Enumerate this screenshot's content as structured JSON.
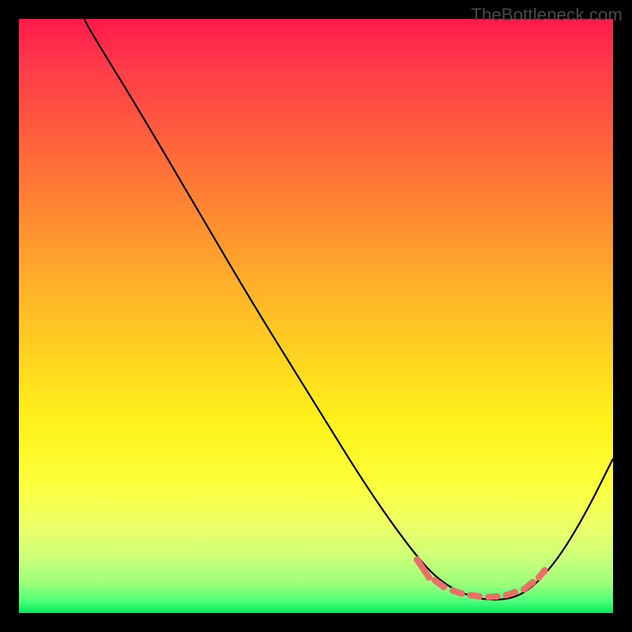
{
  "watermark": "TheBottleneck.com",
  "chart_data": {
    "type": "line",
    "title": "",
    "xlabel": "",
    "ylabel": "",
    "xlim": [
      0,
      100
    ],
    "ylim": [
      0,
      100
    ],
    "curve": [
      {
        "x": 11,
        "y": 100
      },
      {
        "x": 12,
        "y": 98
      },
      {
        "x": 20,
        "y": 85
      },
      {
        "x": 30,
        "y": 68
      },
      {
        "x": 40,
        "y": 51
      },
      {
        "x": 50,
        "y": 35
      },
      {
        "x": 58,
        "y": 22
      },
      {
        "x": 65,
        "y": 12
      },
      {
        "x": 70,
        "y": 6
      },
      {
        "x": 75,
        "y": 3
      },
      {
        "x": 80,
        "y": 2
      },
      {
        "x": 85,
        "y": 3
      },
      {
        "x": 90,
        "y": 8
      },
      {
        "x": 95,
        "y": 16
      },
      {
        "x": 100,
        "y": 26
      }
    ],
    "highlight_range": {
      "x_start": 68,
      "x_end": 87,
      "y": 3
    },
    "highlight_markers": [
      {
        "x1": 67,
        "y1": 9,
        "x2": 69,
        "y2": 6
      },
      {
        "x1": 70,
        "y1": 5.5,
        "x2": 71.5,
        "y2": 4.4
      },
      {
        "x1": 73,
        "y1": 3.8,
        "x2": 74.5,
        "y2": 3.3
      },
      {
        "x1": 76,
        "y1": 3.0,
        "x2": 77.5,
        "y2": 2.8
      },
      {
        "x1": 79,
        "y1": 2.7,
        "x2": 80.5,
        "y2": 2.8
      },
      {
        "x1": 82,
        "y1": 3.0,
        "x2": 83.5,
        "y2": 3.5
      },
      {
        "x1": 85,
        "y1": 4.0,
        "x2": 86.5,
        "y2": 5.2
      },
      {
        "x1": 87.5,
        "y1": 6.0,
        "x2": 88.5,
        "y2": 7.2
      }
    ]
  }
}
